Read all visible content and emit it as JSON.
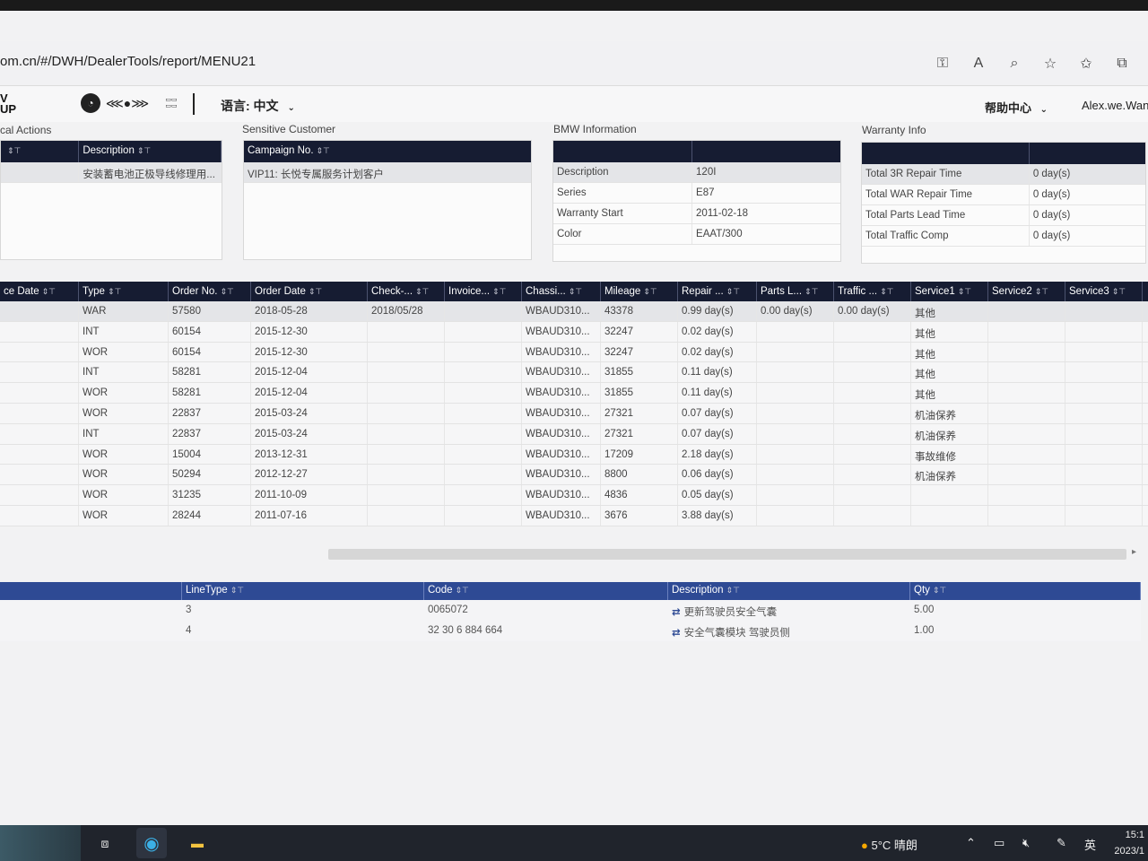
{
  "browser": {
    "url": "om.cn/#/DWH/DealerTools/report/MENU21",
    "icons": [
      "key-icon",
      "read-aloud-icon",
      "zoom-icon",
      "favorite-add-icon",
      "favorites-icon",
      "collections-icon"
    ]
  },
  "header": {
    "logo_text_1": "V",
    "logo_text_2": "UP",
    "language_label": "语言: 中文",
    "help_label": "帮助中心",
    "user_name": "Alex.we.Wan"
  },
  "panels": {
    "local_actions": {
      "title": "cal Actions",
      "columns": [
        "",
        "Description"
      ],
      "rows": [
        [
          "",
          "安装蓄电池正极导线修理用..."
        ]
      ]
    },
    "sensitive_customer": {
      "title": "Sensitive Customer",
      "columns": [
        "Campaign No."
      ],
      "rows": [
        [
          "VIP11: 长悦专属服务计划客户"
        ]
      ]
    },
    "bmw_information": {
      "title": "BMW Information",
      "rows": [
        [
          "Description",
          "120I"
        ],
        [
          "Series",
          "E87"
        ],
        [
          "Warranty Start",
          "2011-02-18"
        ],
        [
          "Color",
          "EAAT/300"
        ]
      ]
    },
    "warranty_info": {
      "title": "Warranty Info",
      "rows": [
        [
          "Total 3R Repair Time",
          "0 day(s)"
        ],
        [
          "Total WAR Repair Time",
          "0 day(s)"
        ],
        [
          "Total Parts Lead Time",
          "0 day(s)"
        ],
        [
          "Total Traffic Comp",
          "0 day(s)"
        ]
      ]
    }
  },
  "orders": {
    "columns": [
      "ce Date",
      "Type",
      "Order No.",
      "Order Date",
      "Check-...",
      "Invoice...",
      "Chassi...",
      "Mileage",
      "Repair ...",
      "Parts L...",
      "Traffic ...",
      "Service1",
      "Service2",
      "Service3"
    ],
    "rows": [
      [
        "",
        "WAR",
        "57580",
        "2018-05-28",
        "2018/05/28",
        "",
        "WBAUD310...",
        "43378",
        "0.99 day(s)",
        "0.00 day(s)",
        "0.00 day(s)",
        "其他",
        "",
        ""
      ],
      [
        "",
        "INT",
        "60154",
        "2015-12-30",
        "",
        "",
        "WBAUD310...",
        "32247",
        "0.02 day(s)",
        "",
        "",
        "其他",
        "",
        ""
      ],
      [
        "",
        "WOR",
        "60154",
        "2015-12-30",
        "",
        "",
        "WBAUD310...",
        "32247",
        "0.02 day(s)",
        "",
        "",
        "其他",
        "",
        ""
      ],
      [
        "",
        "INT",
        "58281",
        "2015-12-04",
        "",
        "",
        "WBAUD310...",
        "31855",
        "0.11 day(s)",
        "",
        "",
        "其他",
        "",
        ""
      ],
      [
        "",
        "WOR",
        "58281",
        "2015-12-04",
        "",
        "",
        "WBAUD310...",
        "31855",
        "0.11 day(s)",
        "",
        "",
        "其他",
        "",
        ""
      ],
      [
        "",
        "WOR",
        "22837",
        "2015-03-24",
        "",
        "",
        "WBAUD310...",
        "27321",
        "0.07 day(s)",
        "",
        "",
        "机油保养",
        "",
        ""
      ],
      [
        "",
        "INT",
        "22837",
        "2015-03-24",
        "",
        "",
        "WBAUD310...",
        "27321",
        "0.07 day(s)",
        "",
        "",
        "机油保养",
        "",
        ""
      ],
      [
        "",
        "WOR",
        "15004",
        "2013-12-31",
        "",
        "",
        "WBAUD310...",
        "17209",
        "2.18 day(s)",
        "",
        "",
        "事故维修",
        "",
        ""
      ],
      [
        "",
        "WOR",
        "50294",
        "2012-12-27",
        "",
        "",
        "WBAUD310...",
        "8800",
        "0.06 day(s)",
        "",
        "",
        "机油保养",
        "",
        ""
      ],
      [
        "",
        "WOR",
        "31235",
        "2011-10-09",
        "",
        "",
        "WBAUD310...",
        "4836",
        "0.05 day(s)",
        "",
        "",
        "",
        "",
        ""
      ],
      [
        "",
        "WOR",
        "28244",
        "2011-07-16",
        "",
        "",
        "WBAUD310...",
        "3676",
        "3.88 day(s)",
        "",
        "",
        "",
        "",
        ""
      ]
    ]
  },
  "lines": {
    "columns": [
      "",
      "LineType",
      "Code",
      "Description",
      "Qty"
    ],
    "rows": [
      [
        "",
        "3",
        "0065072",
        "更新驾驶员安全气囊",
        "5.00"
      ],
      [
        "",
        "4",
        "32 30 6 884 664",
        "安全气囊模块 驾驶员侧",
        "1.00"
      ]
    ]
  },
  "taskbar": {
    "weather": "5°C 晴朗",
    "ime": "英",
    "time": "15:1",
    "date": "2023/1"
  }
}
